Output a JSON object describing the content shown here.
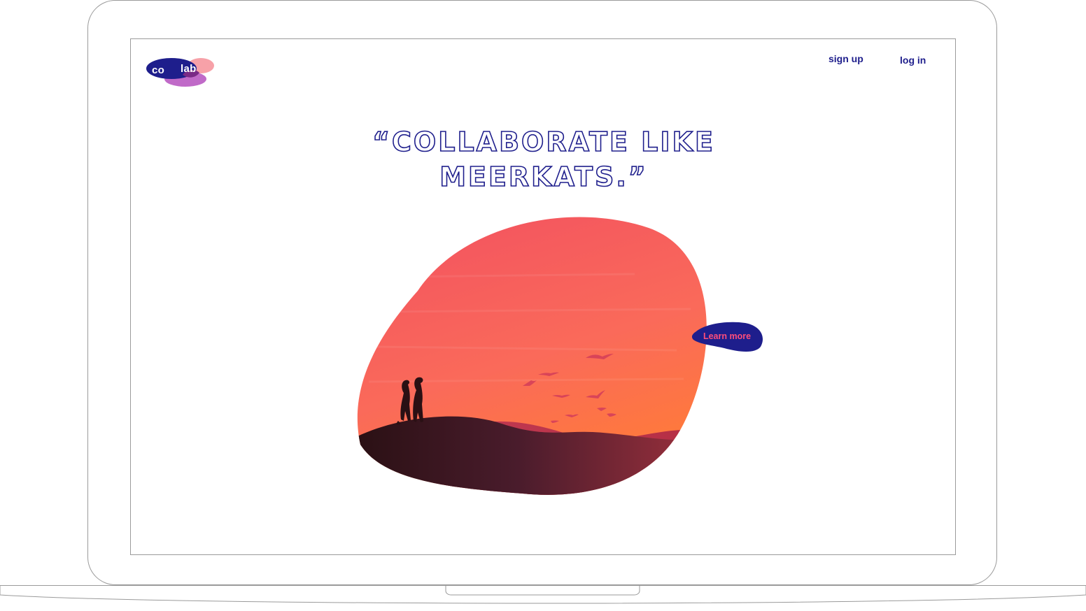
{
  "logo": {
    "part1": "co",
    "part2": "lab"
  },
  "nav": {
    "signup": "sign up",
    "login": "log in"
  },
  "hero": {
    "headline_line1": "“COLLABORATE LIKE",
    "headline_line2": "MEERKATS.”",
    "cta_label": "Learn more",
    "illustration_icon": "meerkats-sunset-illustration"
  },
  "colors": {
    "brand_navy": "#1e1e8c",
    "brand_pink": "#ff4d7a",
    "sky_top": "#f25060",
    "sky_bottom": "#ff7a40",
    "hill_dark": "#2e1418"
  }
}
